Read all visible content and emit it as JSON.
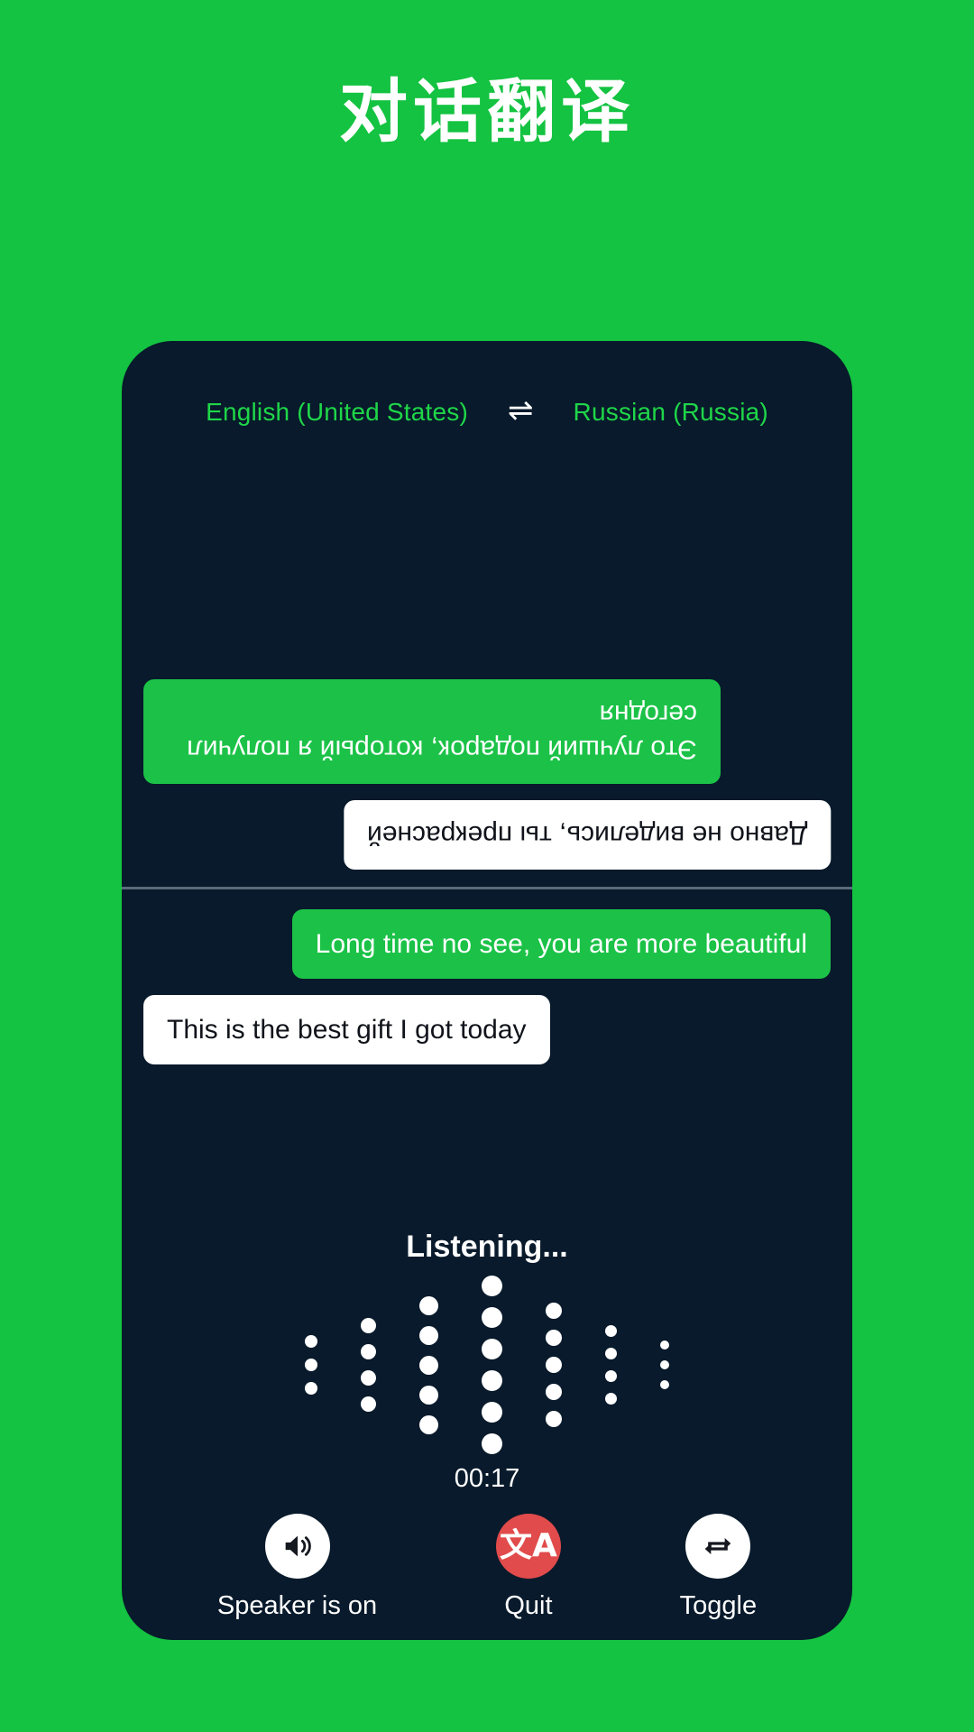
{
  "page": {
    "title": "对话翻译",
    "background_color": "#14c341"
  },
  "card": {
    "background_color": "#081a2b",
    "accent_green": "#1bc247",
    "language_text_color": "#1fd649",
    "danger_color": "#e14b4b"
  },
  "language_bar": {
    "source_language": "English (United States)",
    "swap_icon": "⇌",
    "target_language": "Russian (Russia)"
  },
  "conversation": {
    "remote_pane": [
      {
        "text": "Это лучший подарок, который я получил сегодня",
        "style": "green",
        "align": "left",
        "rotated": true
      },
      {
        "text": "Давно не виделись, ты прекрасней",
        "style": "white",
        "align": "right",
        "rotated": true
      }
    ],
    "local_pane": [
      {
        "text": "Long time no see, you are more beautiful",
        "style": "green",
        "align": "right",
        "rotated": false
      },
      {
        "text": "This is the best gift I got today",
        "style": "white",
        "align": "left",
        "rotated": false
      }
    ]
  },
  "status": {
    "listening_label": "Listening...",
    "timer": "00:17"
  },
  "waveform": {
    "columns": [
      {
        "dots": 3,
        "size": 14
      },
      {
        "dots": 4,
        "size": 17
      },
      {
        "dots": 5,
        "size": 21
      },
      {
        "dots": 6,
        "size": 23
      },
      {
        "dots": 5,
        "size": 18
      },
      {
        "dots": 4,
        "size": 13
      },
      {
        "dots": 3,
        "size": 10
      }
    ],
    "gap": 12,
    "dot_color": "#ffffff"
  },
  "controls": [
    {
      "id": "speaker",
      "label": "Speaker is on",
      "icon": "speaker-on-icon",
      "circle_style": "light"
    },
    {
      "id": "quit",
      "label": "Quit",
      "icon": "translate-icon",
      "glyph": "文A",
      "circle_style": "danger"
    },
    {
      "id": "toggle",
      "label": "Toggle",
      "icon": "swap-arrows-icon",
      "circle_style": "light"
    }
  ]
}
